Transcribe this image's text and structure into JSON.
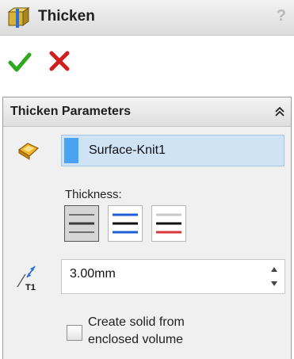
{
  "window": {
    "title": "Thicken",
    "help_label": "?"
  },
  "actions": {
    "ok_icon": "green-checkmark-icon",
    "cancel_icon": "red-x-icon"
  },
  "parameters": {
    "title": "Thicken Parameters",
    "collapse_icon": "double-chevron-up-icon",
    "faces": [
      "Surface-Knit1"
    ],
    "thickness_label": "Thickness:",
    "side_options": [
      {
        "name": "thicken-side-1",
        "selected": true
      },
      {
        "name": "thicken-side-2",
        "selected": false
      },
      {
        "name": "thicken-both-sides",
        "selected": false
      }
    ],
    "depth_value": "3.00mm",
    "depth_icon_label": "T1",
    "create_solid": {
      "line1": "Create solid from",
      "line2": "enclosed volume",
      "checked": false
    }
  },
  "colors": {
    "selection_fill": "#cfe3f5",
    "selection_marker": "#4aa3f0",
    "ok_green": "#2faa1f",
    "cancel_red": "#d21d1d"
  }
}
